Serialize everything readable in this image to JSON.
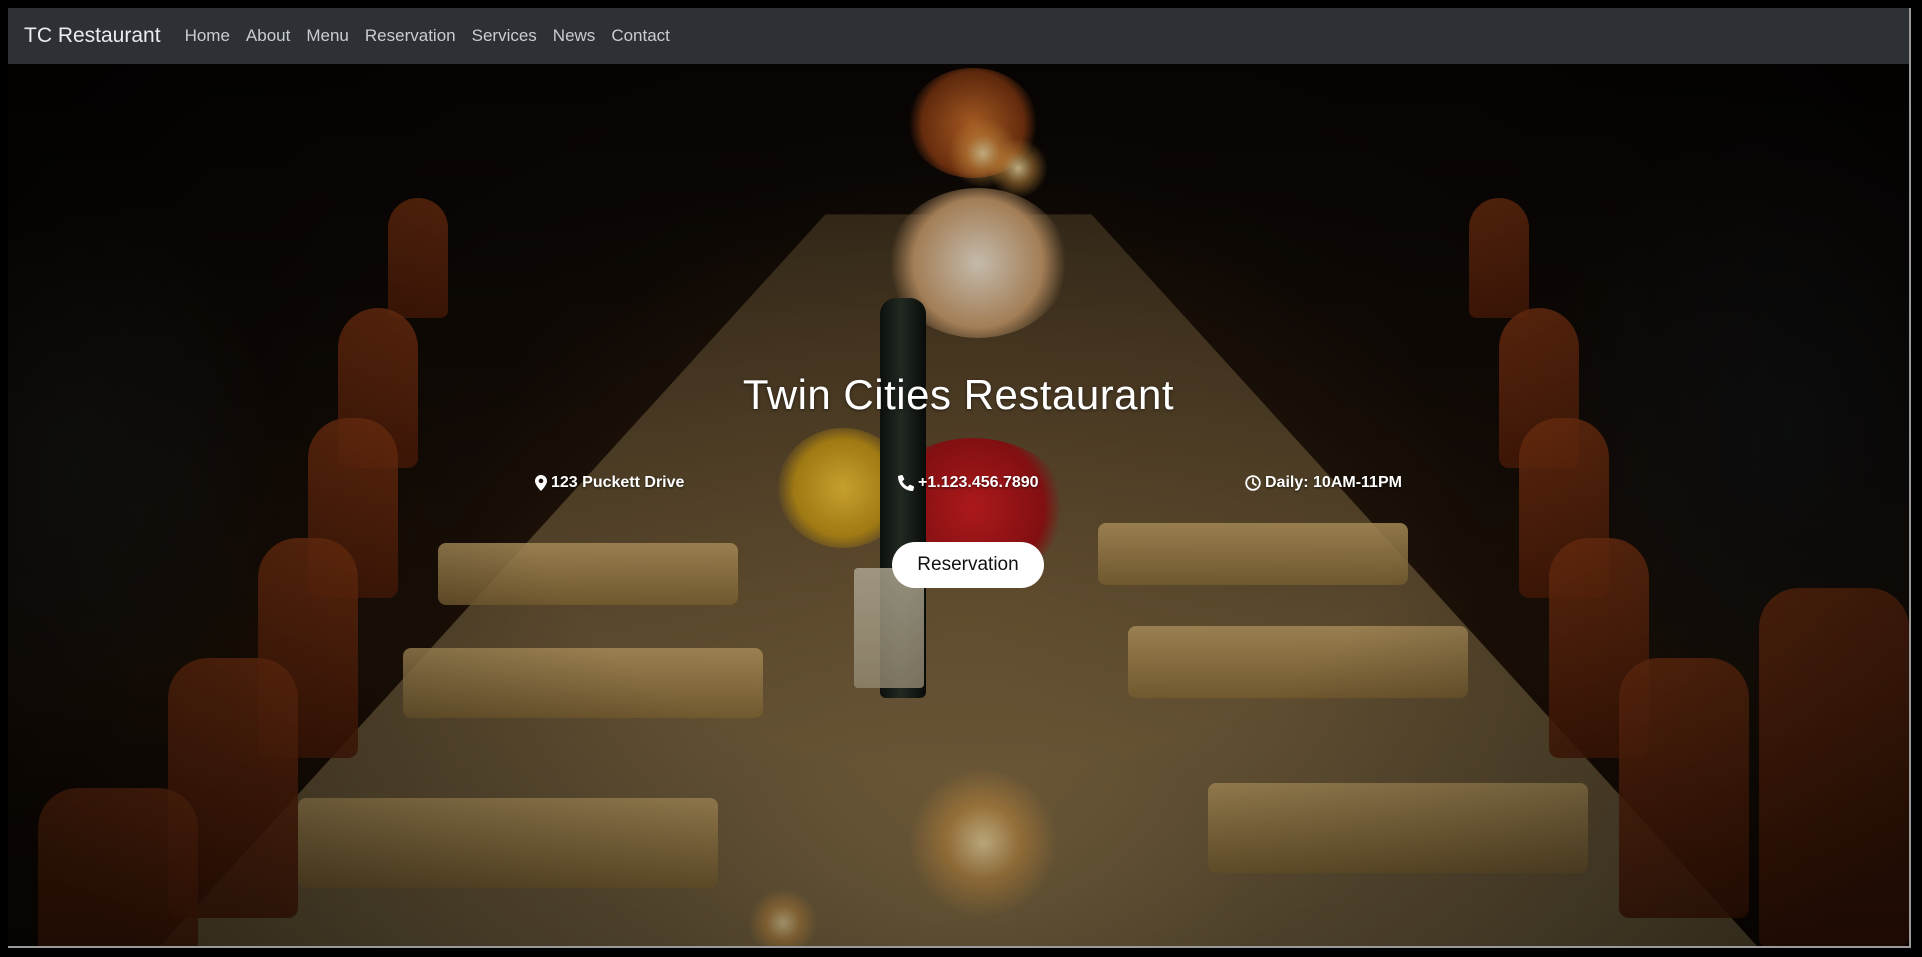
{
  "navbar": {
    "brand": "TC Restaurant",
    "links": [
      {
        "label": "Home"
      },
      {
        "label": "About"
      },
      {
        "label": "Menu"
      },
      {
        "label": "Reservation"
      },
      {
        "label": "Services"
      },
      {
        "label": "News"
      },
      {
        "label": "Contact"
      }
    ]
  },
  "hero": {
    "title": "Twin Cities Restaurant",
    "address": {
      "icon": "map-marker-icon",
      "text": "123 Puckett Drive"
    },
    "phone": {
      "icon": "phone-icon",
      "text": "+1.123.456.7890"
    },
    "hours": {
      "icon": "clock-icon",
      "text": "Daily: 10AM-11PM"
    },
    "cta_label": "Reservation"
  },
  "colors": {
    "navbar_bg": "#303439",
    "nav_text": "#c9ccd0",
    "hero_text": "#ffffff",
    "button_bg": "#ffffff"
  }
}
